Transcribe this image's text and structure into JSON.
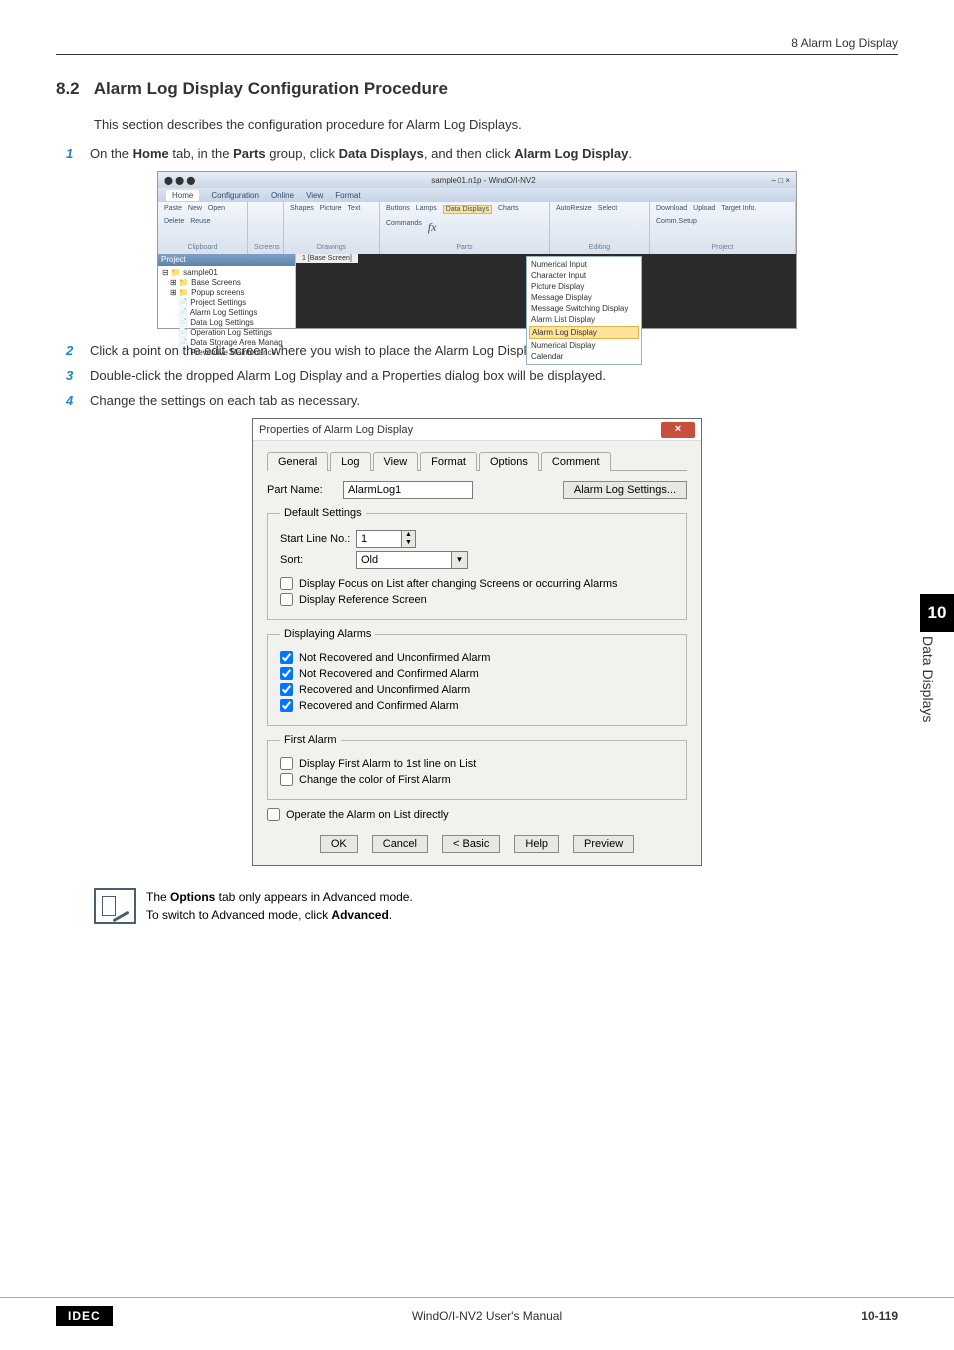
{
  "header": {
    "breadcrumb": "8 Alarm Log Display"
  },
  "section": {
    "number": "8.2",
    "title": "Alarm Log Display Configuration Procedure",
    "intro": "This section describes the configuration procedure for Alarm Log Displays."
  },
  "steps": {
    "s1_n": "1",
    "s1_pre": "On the ",
    "s1_b1": "Home",
    "s1_mid1": " tab, in the ",
    "s1_b2": "Parts",
    "s1_mid2": " group, click ",
    "s1_b3": "Data Displays",
    "s1_mid3": ", and then click ",
    "s1_b4": "Alarm Log Display",
    "s1_end": ".",
    "s2_n": "2",
    "s2_t": "Click a point on the edit screen where you wish to place the Alarm Log Display.",
    "s3_n": "3",
    "s3_t": "Double-click the dropped Alarm Log Display and a Properties dialog box will be displayed.",
    "s4_n": "4",
    "s4_t": "Change the settings on each tab as necessary."
  },
  "app": {
    "title_doc": "sample01.n1p - WindO/I-NV2",
    "tabs": {
      "home": "Home",
      "config": "Configuration",
      "online": "Online",
      "view": "View",
      "format": "Format"
    },
    "ribbon": {
      "clipboard_lbl": "Clipboard",
      "clipboard_items": {
        "paste": "Paste",
        "open": "Open",
        "delete": "Delete",
        "new": "New",
        "reuse": "Reuse"
      },
      "screens_lbl": "Screens",
      "drawings_lbl": "Drawings",
      "drawings_items": {
        "shapes": "Shapes",
        "picture": "Picture",
        "text": "Text"
      },
      "parts_lbl": "Parts",
      "parts_items": {
        "buttons": "Buttons",
        "lamps": "Lamps",
        "data": "Data Displays",
        "charts": "Charts",
        "commands": "Commands"
      },
      "editing_lbl": "Editing",
      "editing_items": {
        "autoresize": "AutoResize",
        "select": "Select"
      },
      "project_lbl": "Project",
      "project_items": {
        "download": "Download",
        "upload": "Upload",
        "target": "Target Info.",
        "comm": "Comm.Setup"
      }
    },
    "tree": {
      "header": "Project",
      "root": "sample01",
      "base": "Base Screens",
      "popup": "Popup screens",
      "proj_settings": "Project Settings",
      "alarm_settings": "Alarm Log Settings",
      "data_log": "Data Log Settings",
      "op_log": "Operation Log Settings",
      "storage": "Data Storage Area Manag",
      "prevent": "Preventive Maintenance"
    },
    "canvas_tab": "1 [Base Screen]",
    "menu": {
      "num_input": "Numerical Input",
      "char_input": "Character Input",
      "pic_display": "Picture Display",
      "msg_display": "Message Display",
      "msg_switch": "Message Switching Display",
      "alarm_list": "Alarm List Display",
      "alarm_log": "Alarm Log Display",
      "num_display": "Numerical Display",
      "calendar": "Calendar"
    }
  },
  "dialog": {
    "title": "Properties of Alarm Log Display",
    "tabs": {
      "general": "General",
      "log": "Log",
      "view": "View",
      "format": "Format",
      "options": "Options",
      "comment": "Comment"
    },
    "part_name_lbl": "Part Name:",
    "part_name_val": "AlarmLog1",
    "alarm_settings_btn": "Alarm Log Settings...",
    "groups": {
      "default": "Default Settings",
      "displaying": "Displaying Alarms",
      "first": "First Alarm"
    },
    "default": {
      "start_line_lbl": "Start Line No.:",
      "start_line_val": "1",
      "sort_lbl": "Sort:",
      "sort_val": "Old",
      "focus_chk": "Display Focus on List after changing Screens or occurring Alarms",
      "ref_chk": "Display Reference Screen"
    },
    "displaying": {
      "nr_unconf": "Not Recovered and Unconfirmed Alarm",
      "nr_conf": "Not Recovered and Confirmed Alarm",
      "r_unconf": "Recovered and Unconfirmed Alarm",
      "r_conf": "Recovered and Confirmed Alarm"
    },
    "first": {
      "display_first": "Display First Alarm to 1st line on List",
      "change_color": "Change the color of First Alarm"
    },
    "operate_chk": "Operate the Alarm on List directly",
    "buttons": {
      "ok": "OK",
      "cancel": "Cancel",
      "basic": "< Basic",
      "help": "Help",
      "preview": "Preview"
    }
  },
  "note": {
    "line1_pre": "The ",
    "line1_b": "Options",
    "line1_post": " tab only appears in Advanced mode.",
    "line2_pre": "To switch to Advanced mode, click ",
    "line2_b": "Advanced",
    "line2_post": "."
  },
  "side": {
    "chapter": "10",
    "label": "Data Displays"
  },
  "footer": {
    "logo": "IDEC",
    "title": "WindO/I-NV2 User's Manual",
    "page": "10-119"
  }
}
